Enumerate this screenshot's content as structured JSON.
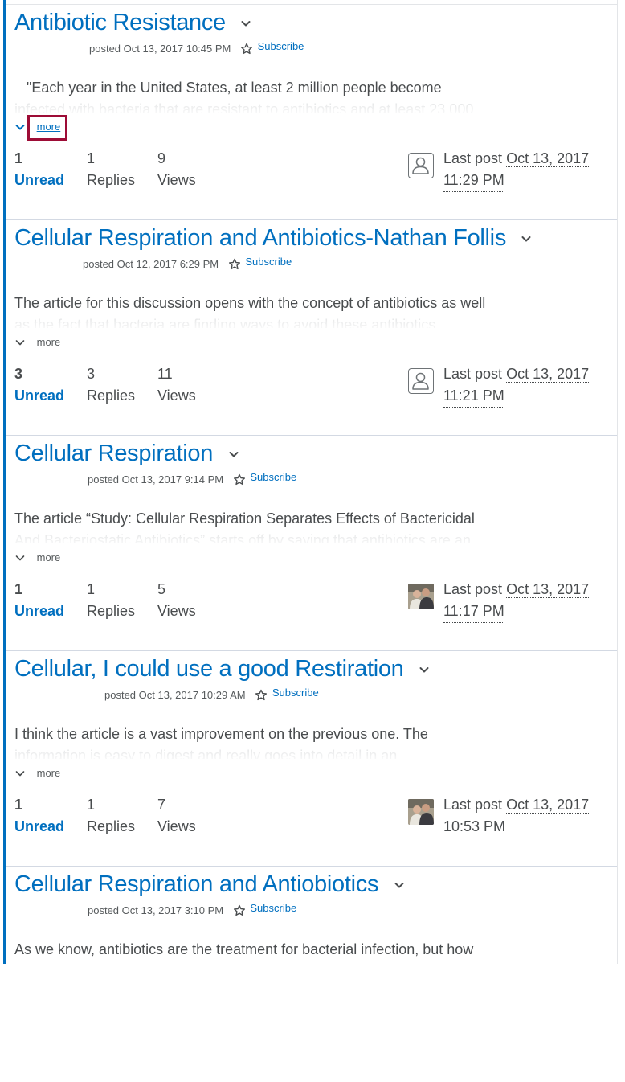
{
  "topics": [
    {
      "title": "Antibiotic Resistance",
      "posted": "posted Oct 13, 2017 10:45 PM",
      "subscribe": "Subscribe",
      "excerpt_line1": "   \"Each year in the United States, at least 2 million people become",
      "excerpt_line2": "infected with bacteria that are resistant to antibiotics and at least 23,000",
      "more": "more",
      "unread_count": "1",
      "unread_label": "Unread",
      "replies_count": "1",
      "replies_label": "Replies",
      "views_count": "9",
      "views_label": "Views",
      "lastpost_label": "Last post",
      "lastpost_date": "Oct 13, 2017",
      "lastpost_time": "11:29 PM",
      "avatar": "user-placeholder-icon"
    },
    {
      "title": "Cellular Respiration and Antibiotics-Nathan Follis",
      "posted": "posted Oct 12, 2017 6:29 PM",
      "subscribe": "Subscribe",
      "excerpt_line1": "The article for this discussion opens with the concept of antibiotics as well",
      "excerpt_line2": "as the fact that bacteria are finding ways to avoid these antibiotics.",
      "more": "more",
      "unread_count": "3",
      "unread_label": "Unread",
      "replies_count": "3",
      "replies_label": "Replies",
      "views_count": "11",
      "views_label": "Views",
      "lastpost_label": "Last post",
      "lastpost_date": "Oct 13, 2017",
      "lastpost_time": "11:21 PM",
      "avatar": "user-placeholder-icon"
    },
    {
      "title": "Cellular Respiration",
      "posted": "posted Oct 13, 2017 9:14 PM",
      "subscribe": "Subscribe",
      "excerpt_line1": "The article “Study: Cellular Respiration Separates Effects of Bactericidal",
      "excerpt_line2": "And Bacteriostatic Antibiotics” starts off by saying that antibiotics are an",
      "more": "more",
      "unread_count": "1",
      "unread_label": "Unread",
      "replies_count": "1",
      "replies_label": "Replies",
      "views_count": "5",
      "views_label": "Views",
      "lastpost_label": "Last post",
      "lastpost_date": "Oct 13, 2017",
      "lastpost_time": "11:17 PM",
      "avatar": "user-photo"
    },
    {
      "title": "Cellular, I could use a good Restiration",
      "posted": "posted Oct 13, 2017 10:29 AM",
      "subscribe": "Subscribe",
      "excerpt_line1": "I think the article is a vast improvement on the previous one. The",
      "excerpt_line2": "information is easy to digest and really goes into detail in an",
      "more": "more",
      "unread_count": "1",
      "unread_label": "Unread",
      "replies_count": "1",
      "replies_label": "Replies",
      "views_count": "7",
      "views_label": "Views",
      "lastpost_label": "Last post",
      "lastpost_date": "Oct 13, 2017",
      "lastpost_time": "10:53 PM",
      "avatar": "user-photo"
    },
    {
      "title": "Cellular Respiration and Antiobiotics",
      "posted": "posted Oct 13, 2017 3:10 PM",
      "subscribe": "Subscribe",
      "excerpt_line1": "As we know, antibiotics are the treatment for bacterial infection, but how"
    }
  ],
  "colors": {
    "accent": "#006fbf",
    "focus_outline": "#9d0c36",
    "text": "#494c4e"
  }
}
